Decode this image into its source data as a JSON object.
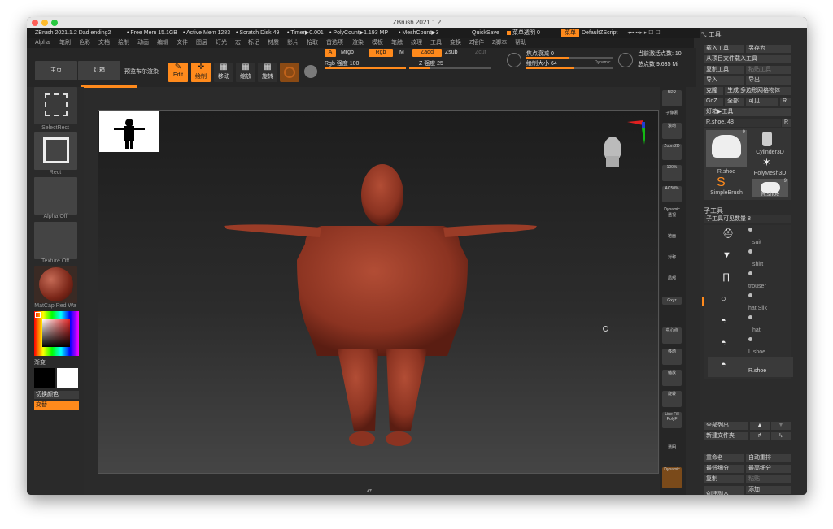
{
  "window": {
    "title": "ZBrush 2021.1.2"
  },
  "info_bar": {
    "doc": "ZBrush 2021.1.2 Dad ending2",
    "free_mem": "• Free Mem 15.1GB",
    "active_mem": "• Active Mem 1283",
    "scratch": "• Scratch Disk 49",
    "timer": "• Timer▶0.001",
    "polycount": "• PolyCount▶1.193 MP",
    "meshcount": "• MeshCount▶3",
    "quicksave": "QuickSave",
    "transparency": "菜单透明 0",
    "menus_btn": "菜单",
    "zscript": "DefaultZScript"
  },
  "menus": [
    "Alpha",
    "笔刷",
    "色彩",
    "文档",
    "绘制",
    "动画",
    "编辑",
    "文件",
    "图层",
    "灯光",
    "宏",
    "标记",
    "材质",
    "影片",
    "拾取",
    "首选项",
    "渲染",
    "模板",
    "笔触",
    "纹理",
    "工具",
    "变换",
    "Z插件",
    "Z脚本",
    "帮助"
  ],
  "toolbar": {
    "home": "主页",
    "lightbox": "灯箱",
    "preview": "预览布尔渲染",
    "edit": "Edit",
    "draw": "绘制",
    "move": "移动",
    "scale": "缩放",
    "rotate": "旋转",
    "a_label": "A",
    "mrgb": "Mrgb",
    "rgb": "Rgb",
    "m": "M",
    "zadd": "Zadd",
    "zsub": "Zsub",
    "zcut": "Zcut",
    "rgb_intensity": "Rgb 强度 100",
    "z_intensity": "Z 强度 25",
    "focal_shift": "焦点衰减 0",
    "draw_size": "绘制大小 64",
    "dynamic": "Dynamic",
    "active_points": "当前激活点数: 10",
    "total_points": "总点数 9.635 Mi"
  },
  "left": {
    "select_rect": "SelectRect",
    "rect": "Rect",
    "alpha_off": "Alpha Off",
    "texture_off": "Texture Off",
    "matcap": "MatCap Red Wa",
    "gradient": "渐变",
    "switch_color": "切换颜色",
    "alternate": "交替"
  },
  "right_strip": [
    "BPR",
    "子像素",
    "滚动",
    "Zoom2D",
    "100%",
    "AC50%",
    "Dynamic",
    "透视",
    "地面",
    "对称",
    "局部",
    "Gxyz",
    "中心点",
    "移动",
    "缩放",
    "旋转",
    "Line Fill",
    "PolyF",
    "透明",
    "Dynamic"
  ],
  "tool_panel": {
    "header": "工具",
    "load_tool": "载入工具",
    "save_as": "另存为",
    "load_from_project": "从项目文件载入工具",
    "copy_tool": "复制工具",
    "paste_tool": "粘贴工具",
    "import": "导入",
    "export": "导出",
    "clone": "克隆",
    "make_polymesh": "生成 多边形网格物体",
    "goz": "GoZ",
    "all": "全部",
    "visible": "可见",
    "r": "R",
    "lightbox_tools": "灯箱▶工具",
    "current_tool": "R.shoe. 48",
    "r2": "R",
    "tools": [
      {
        "name": "R.shoe",
        "badge": "9"
      },
      {
        "name": "Cylinder3D",
        "badge": ""
      },
      {
        "name": "SimpleBrush",
        "badge": ""
      },
      {
        "name": "PolyMesh3D",
        "badge": ""
      },
      {
        "name": "R.shoe",
        "badge": "9"
      }
    ],
    "subtool_header": "子工具",
    "visible_count": "子工具可见数量 8",
    "subtools": [
      "suit",
      "shirt",
      "trouser",
      "hat Silk",
      "hat",
      "L.shoe",
      "R.shoe"
    ],
    "list_all": "全部列出",
    "new_folder": "新建文件夹",
    "rename": "重命名",
    "auto_reorder": "自动重排",
    "all_low": "最低细分",
    "all_high": "最高细分",
    "copy": "复制",
    "paste": "粘贴",
    "append": "添加",
    "duplicate": "创建副本",
    "insert": "插入"
  }
}
